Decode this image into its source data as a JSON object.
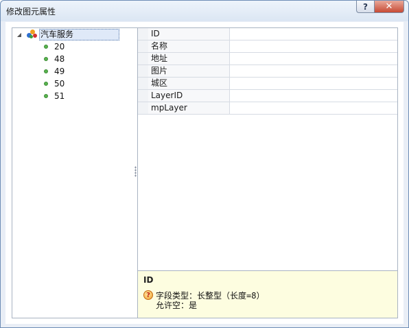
{
  "window": {
    "title": "修改图元属性",
    "help_button": "?",
    "close_button": "✕"
  },
  "tree": {
    "root_label": "汽车服务",
    "children": [
      "20",
      "48",
      "49",
      "50",
      "51"
    ]
  },
  "properties": {
    "names": [
      "ID",
      "名称",
      "地址",
      "图片",
      "城区",
      "LayerID",
      "mpLayer"
    ]
  },
  "help": {
    "title": "ID",
    "line1": "字段类型：长整型（长度=8）",
    "line2": "允许空：是"
  },
  "colors": {
    "selection": "#dfe9f8",
    "help_background": "#fdfde0",
    "close_button": "#c74a34"
  }
}
